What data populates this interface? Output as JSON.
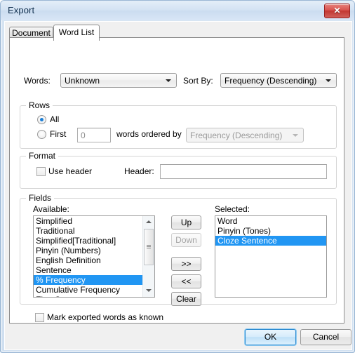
{
  "window": {
    "title": "Export",
    "close_label": "✕"
  },
  "tabs": [
    {
      "label": "Document",
      "active": false
    },
    {
      "label": "Word List",
      "active": true
    }
  ],
  "top_controls": {
    "words_label": "Words:",
    "words_value": "Unknown",
    "sort_by_label": "Sort By:",
    "sort_by_value": "Frequency (Descending)"
  },
  "rows_group": {
    "title": "Rows",
    "all_label": "All",
    "all_selected": true,
    "first_label": "First",
    "first_selected": false,
    "first_count_value": "0",
    "words_ordered_by_label": "words ordered by",
    "ordered_by_value": "Frequency (Descending)"
  },
  "format_group": {
    "title": "Format",
    "use_header_label": "Use header",
    "use_header_checked": false,
    "header_label": "Header:",
    "header_value": ""
  },
  "fields_group": {
    "title": "Fields",
    "available_label": "Available:",
    "available_items": [
      "Simplified",
      "Traditional",
      "Simplified[Traditional]",
      "Pinyin (Numbers)",
      "English Definition",
      "Sentence",
      "% Frequency",
      "Cumulative Frequency",
      "First Occurence"
    ],
    "available_selected_index": 6,
    "selected_label": "Selected:",
    "selected_items": [
      "Word",
      "Pinyin (Tones)",
      "Cloze Sentence"
    ],
    "selected_selected_index": 2,
    "buttons": {
      "up": "Up",
      "down": "Down",
      "add": ">>",
      "remove": "<<",
      "clear": "Clear"
    }
  },
  "footer": {
    "mark_known_label": "Mark exported words as known",
    "mark_known_checked": false,
    "ok_label": "OK",
    "cancel_label": "Cancel"
  },
  "colors": {
    "selection": "#2196f3",
    "title_text": "#12314f",
    "close_red": "#c23732",
    "accent_blue": "#2c8bd0"
  }
}
